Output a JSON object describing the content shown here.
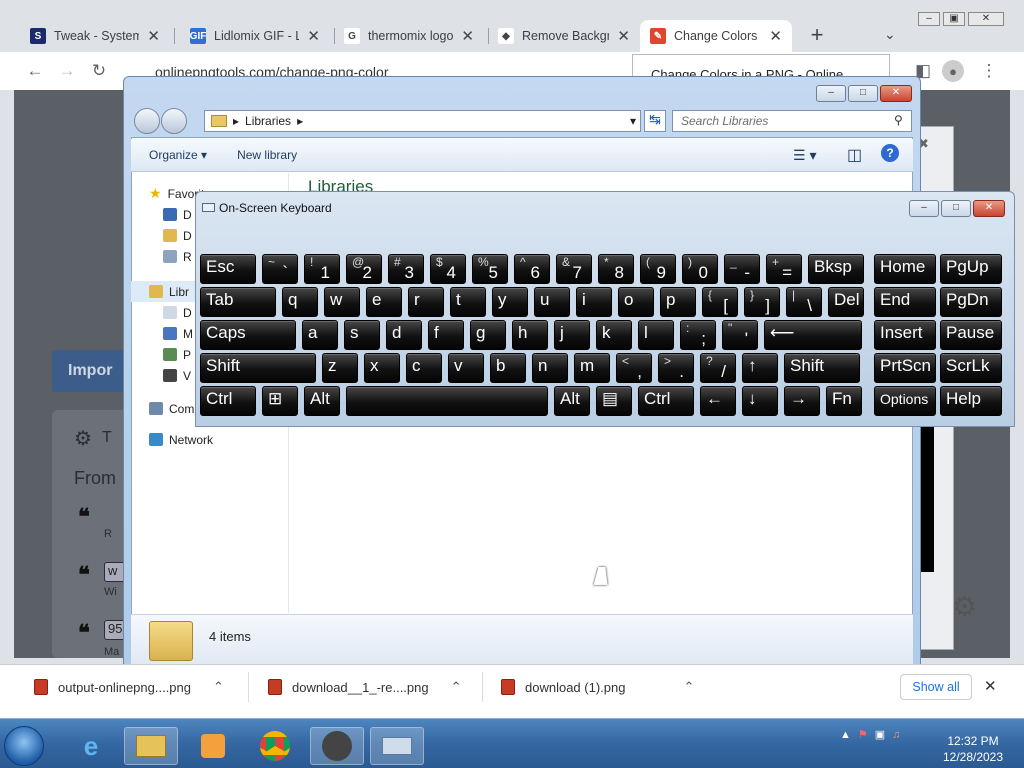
{
  "browser": {
    "tabs": [
      {
        "title": "Tweak - System T",
        "favicon": "S",
        "color": "#1b2a6b"
      },
      {
        "title": "Lidlomix GIF - Lid",
        "favicon": "GIF",
        "color": "#2f6fd6"
      },
      {
        "title": "thermomix logo",
        "favicon": "G",
        "color": "#fff"
      },
      {
        "title": "Remove Backgrc",
        "favicon": "◆",
        "color": "#fff"
      },
      {
        "title": "Change Colors ir",
        "favicon": "✎",
        "color": "#e0462d"
      }
    ],
    "new_tab": "+",
    "url": "onlinepngtools.com/change-png-color",
    "tooltip": "Change Colors in a PNG - Online",
    "page": {
      "import_label": "Impor",
      "section_icon": "gear-icon",
      "section_letter": "T",
      "from_label": "From",
      "quote_items": [
        "❝",
        "❝",
        "❝"
      ],
      "item_labels": [
        "R",
        "Wi",
        "Ma"
      ],
      "item_prefix": [
        "w",
        "95"
      ]
    }
  },
  "downloads": {
    "items": [
      {
        "name": "output-onlinepng....png"
      },
      {
        "name": "download__1_-re....png"
      },
      {
        "name": "download (1).png"
      }
    ],
    "show_all": "Show all",
    "close": "✕"
  },
  "explorer": {
    "title": "Libraries",
    "address": "Libraries",
    "search_placeholder": "Search Libraries",
    "toolbar": {
      "organize": "Organize ▾",
      "new_library": "New library"
    },
    "heading": "Libraries",
    "nav": {
      "favorites": "Favorites",
      "fav_items": [
        "D",
        "D",
        "R"
      ],
      "libraries": "Libr",
      "lib_items": [
        "D",
        "M",
        "P",
        "V"
      ],
      "computer": "Com",
      "network": "Network"
    },
    "status": "4 items"
  },
  "osk": {
    "title": "On-Screen Keyboard",
    "rows": [
      [
        {
          "m": "Esc",
          "w": 58
        },
        {
          "s": "~",
          "m": "`",
          "w": 38
        },
        {
          "s": "!",
          "m": "1",
          "w": 38
        },
        {
          "s": "@",
          "m": "2",
          "w": 38
        },
        {
          "s": "#",
          "m": "3",
          "w": 38
        },
        {
          "s": "$",
          "m": "4",
          "w": 38
        },
        {
          "s": "%",
          "m": "5",
          "w": 38
        },
        {
          "s": "^",
          "m": "6",
          "w": 38
        },
        {
          "s": "&",
          "m": "7",
          "w": 38
        },
        {
          "s": "*",
          "m": "8",
          "w": 38
        },
        {
          "s": "(",
          "m": "9",
          "w": 38
        },
        {
          "s": ")",
          "m": "0",
          "w": 38
        },
        {
          "s": "_",
          "m": "-",
          "w": 38
        },
        {
          "s": "+",
          "m": "=",
          "w": 38
        },
        {
          "m": "Bksp",
          "w": 58
        }
      ],
      [
        {
          "m": "Tab",
          "w": 78
        },
        {
          "m": "q",
          "w": 38
        },
        {
          "m": "w",
          "w": 38
        },
        {
          "m": "e",
          "w": 38
        },
        {
          "m": "r",
          "w": 38
        },
        {
          "m": "t",
          "w": 38
        },
        {
          "m": "y",
          "w": 38
        },
        {
          "m": "u",
          "w": 38
        },
        {
          "m": "i",
          "w": 38
        },
        {
          "m": "o",
          "w": 38
        },
        {
          "m": "p",
          "w": 38
        },
        {
          "s": "{",
          "m": "[",
          "w": 38
        },
        {
          "s": "}",
          "m": "]",
          "w": 38
        },
        {
          "s": "|",
          "m": "\\",
          "w": 38
        },
        {
          "m": "Del",
          "w": 38
        }
      ],
      [
        {
          "m": "Caps",
          "w": 98
        },
        {
          "m": "a",
          "w": 38
        },
        {
          "m": "s",
          "w": 38
        },
        {
          "m": "d",
          "w": 38
        },
        {
          "m": "f",
          "w": 38
        },
        {
          "m": "g",
          "w": 38
        },
        {
          "m": "h",
          "w": 38
        },
        {
          "m": "j",
          "w": 38
        },
        {
          "m": "k",
          "w": 38
        },
        {
          "m": "l",
          "w": 38
        },
        {
          "s": ":",
          "m": ";",
          "w": 38
        },
        {
          "s": "\"",
          "m": "'",
          "w": 38
        },
        {
          "m": "⟵",
          "w": 100
        }
      ],
      [
        {
          "m": "Shift",
          "w": 118
        },
        {
          "m": "z",
          "w": 38
        },
        {
          "m": "x",
          "w": 38
        },
        {
          "m": "c",
          "w": 38
        },
        {
          "m": "v",
          "w": 38
        },
        {
          "m": "b",
          "w": 38
        },
        {
          "m": "n",
          "w": 38
        },
        {
          "m": "m",
          "w": 38
        },
        {
          "s": "<",
          "m": ",",
          "w": 38
        },
        {
          "s": ">",
          "m": ".",
          "w": 38
        },
        {
          "s": "?",
          "m": "/",
          "w": 38
        },
        {
          "m": "↑",
          "w": 38
        },
        {
          "m": "Shift",
          "w": 78
        }
      ],
      [
        {
          "m": "Ctrl",
          "w": 58
        },
        {
          "m": "⊞",
          "w": 38
        },
        {
          "m": "Alt",
          "w": 38
        },
        {
          "m": "",
          "w": 204
        },
        {
          "m": "Alt",
          "w": 38
        },
        {
          "m": "▤",
          "w": 38
        },
        {
          "m": "Ctrl",
          "w": 58
        },
        {
          "m": "←",
          "w": 38
        },
        {
          "m": "↓",
          "w": 38
        },
        {
          "m": "→",
          "w": 38
        },
        {
          "m": "Fn",
          "w": 38
        }
      ]
    ],
    "nav_keys": [
      [
        "Home",
        "PgUp"
      ],
      [
        "End",
        "PgDn"
      ],
      [
        "Insert",
        "Pause"
      ],
      [
        "PrtScn",
        "ScrLk"
      ],
      [
        "Options",
        "Help"
      ]
    ]
  },
  "taskbar": {
    "clock_time": "12:32 PM",
    "clock_date": "12/28/2023",
    "tray_icons": [
      "▲",
      "⚑",
      "▣",
      "♫"
    ],
    "accent": "#3567a2"
  }
}
